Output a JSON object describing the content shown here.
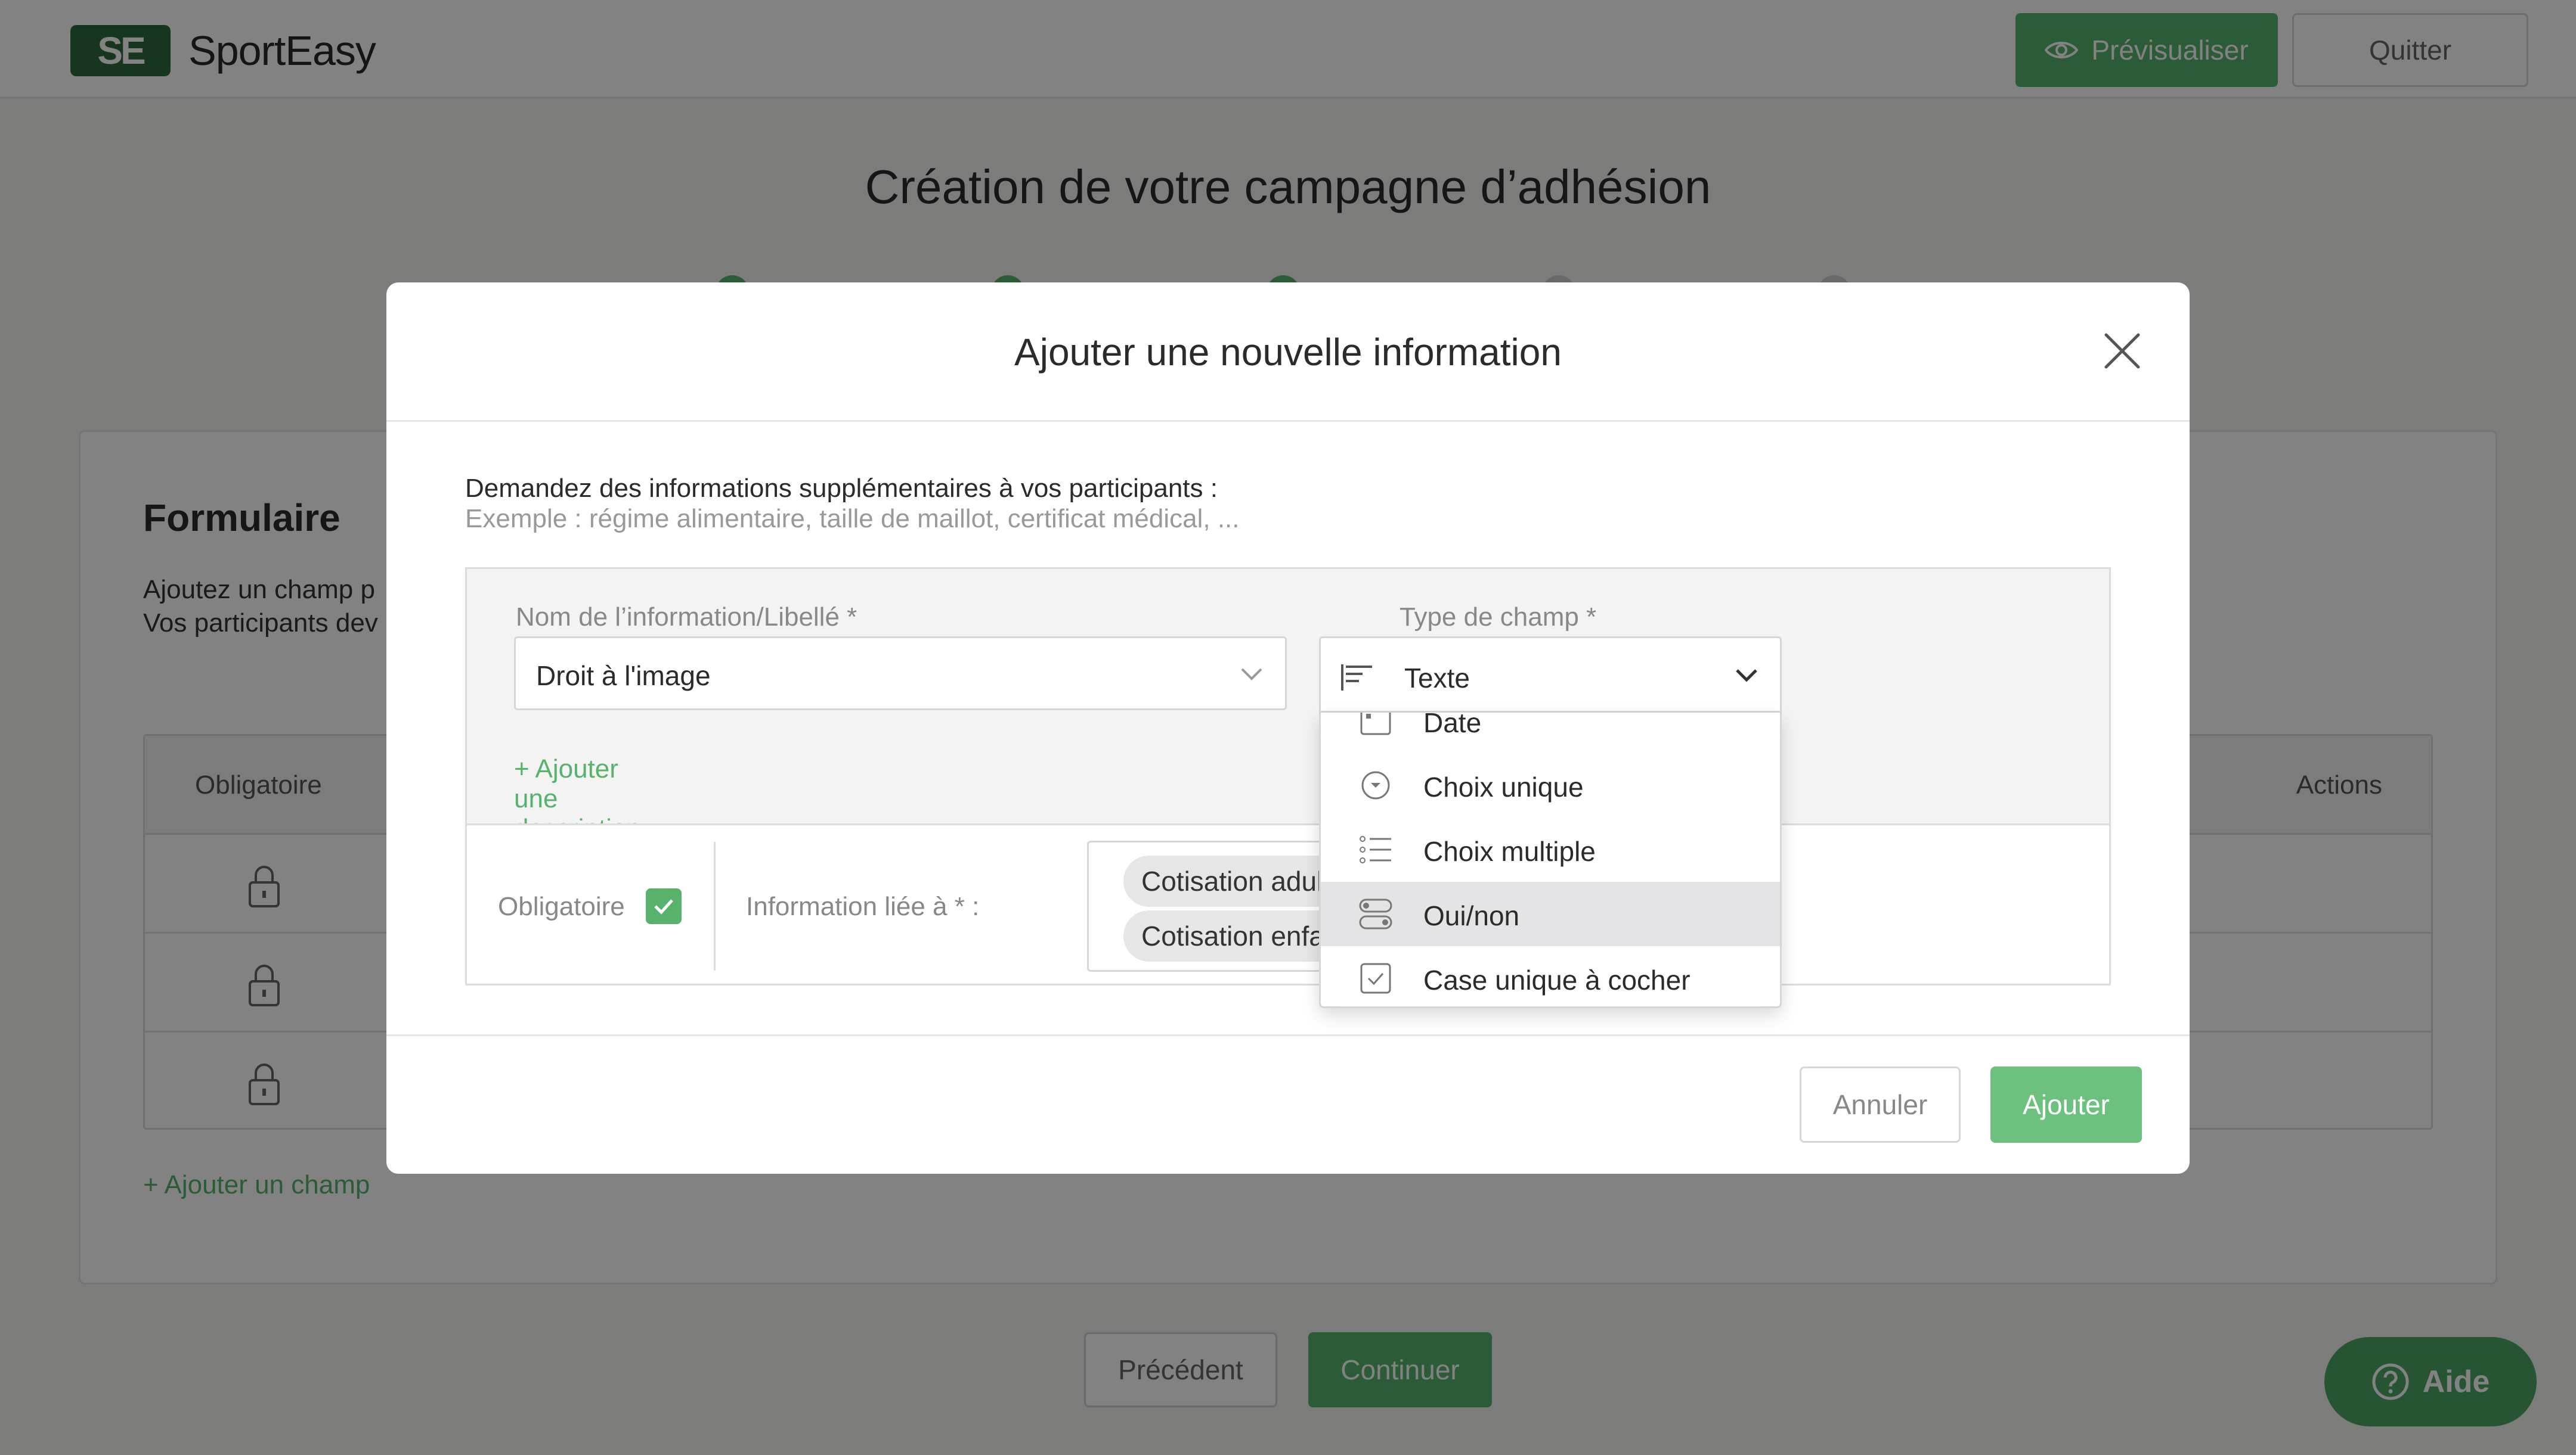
{
  "header": {
    "logo_text": "SportEasy",
    "logo_mark": "SE",
    "preview_label": "Prévisualiser",
    "preview_icon": "eye-icon",
    "quit_label": "Quitter"
  },
  "page": {
    "title": "Création de votre campagne d’adhésion"
  },
  "form_card": {
    "title": "Formulaire",
    "desc_line1": "Ajoutez un champ p",
    "desc_line2": "Vos participants dev",
    "table": {
      "col_required": "Obligatoire",
      "col_actions": "Actions"
    },
    "add_field_label": "+ Ajouter un champ"
  },
  "nav": {
    "previous_label": "Précédent",
    "continue_label": "Continuer"
  },
  "help": {
    "label": "Aide"
  },
  "modal": {
    "title": "Ajouter une nouvelle information",
    "intro": "Demandez des informations supplémentaires à vos participants :",
    "example": "Exemple : régime alimentaire, taille de maillot, certificat médical, ...",
    "name_label": "Nom de l’information/Libellé *",
    "name_value": "Droit à l'image",
    "type_label": "Type de champ *",
    "type_value": "Texte",
    "add_description": "+ Ajouter une description",
    "required_label": "Obligatoire",
    "required_checked": true,
    "linked_label": "Information liée à * :",
    "linked_tags": [
      "Cotisation adultes",
      "Cotisation enfants"
    ],
    "dropdown_options": [
      {
        "label": "Date",
        "icon": "calendar-icon"
      },
      {
        "label": "Choix unique",
        "icon": "radio-icon"
      },
      {
        "label": "Choix multiple",
        "icon": "list-icon"
      },
      {
        "label": "Oui/non",
        "icon": "toggle-icon",
        "selected": true
      },
      {
        "label": "Case unique à cocher",
        "icon": "checkbox-icon"
      }
    ],
    "cancel_label": "Annuler",
    "add_label": "Ajouter"
  },
  "colors": {
    "brand_green": "#57b36c",
    "logo_green": "#2d6a3f"
  }
}
